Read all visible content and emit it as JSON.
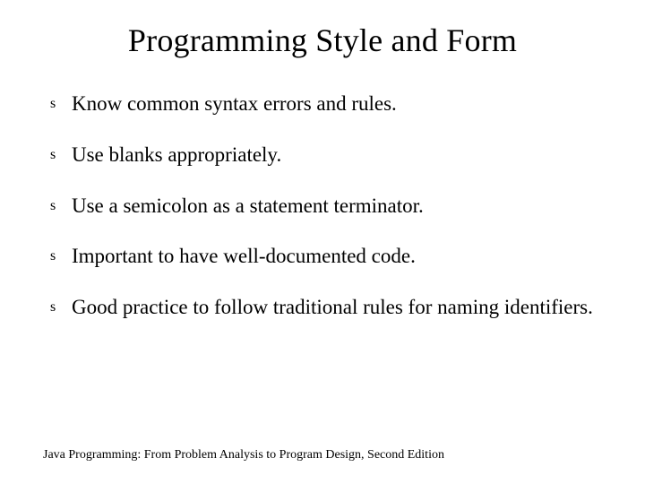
{
  "title": "Programming Style and Form",
  "bullets": {
    "marker": "s",
    "items": [
      "Know common syntax errors and rules.",
      "Use blanks appropriately.",
      "Use a semicolon as a statement terminator.",
      "Important to have well-documented code.",
      "Good practice to follow traditional rules for naming identifiers."
    ]
  },
  "footer": "Java Programming: From Problem Analysis to Program Design, Second Edition"
}
